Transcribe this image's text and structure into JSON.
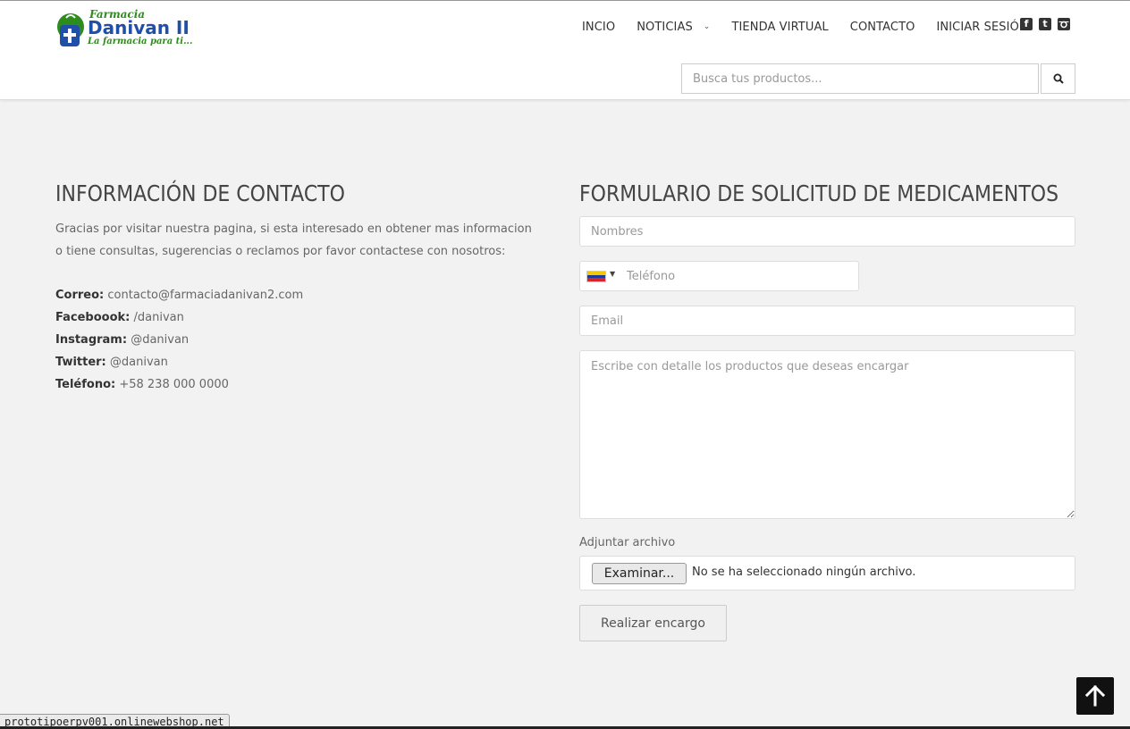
{
  "logo": {
    "line1": "Farmacia",
    "line2": "Danivan II",
    "line3": "La farmacia para ti..."
  },
  "nav": {
    "items": [
      {
        "label": "INCIO"
      },
      {
        "label": "NOTICIAS"
      },
      {
        "label": "TIENDA VIRTUAL"
      },
      {
        "label": "CONTACTO"
      },
      {
        "label": "INICIAR SESIÓN"
      }
    ],
    "social": [
      "facebook-square-icon",
      "twitter-square-icon",
      "instagram-icon"
    ]
  },
  "search": {
    "placeholder": "Busca tus productos..."
  },
  "contact_info": {
    "title": "INFORMACIÓN DE CONTACTO",
    "intro": "Gracias por visitar nuestra pagina, si esta interesado en obtener mas informacion o tiene consultas, sugerencias o reclamos por favor contactese con nosotros:",
    "rows": [
      {
        "label": "Correo:",
        "value": "contacto@farmaciadanivan2.com"
      },
      {
        "label": "Faceboook:",
        "value": "/danivan"
      },
      {
        "label": "Instagram:",
        "value": "@danivan"
      },
      {
        "label": "Twitter:",
        "value": "@danivan"
      },
      {
        "label": "Teléfono:",
        "value": "+58 238 000 0000"
      }
    ]
  },
  "form": {
    "title": "FORMULARIO DE SOLICITUD DE MEDICAMENTOS",
    "name_placeholder": "Nombres",
    "phone_placeholder": "Teléfono",
    "email_placeholder": "Email",
    "details_placeholder": "Escribe con detalle los productos que deseas encargar",
    "attach_label": "Adjuntar archivo",
    "file_button": "Examinar...",
    "file_status": "No se ha seleccionado ningún archivo.",
    "submit_label": "Realizar encargo"
  },
  "status_bar": "prototipoerpv001.onlinewebshop.net",
  "colors": {
    "logo_green": "#2e8b1e",
    "logo_blue": "#1f4fa8",
    "flag_yellow": "#f4c900",
    "flag_blue": "#1a3a9c",
    "flag_red": "#d9252a"
  }
}
